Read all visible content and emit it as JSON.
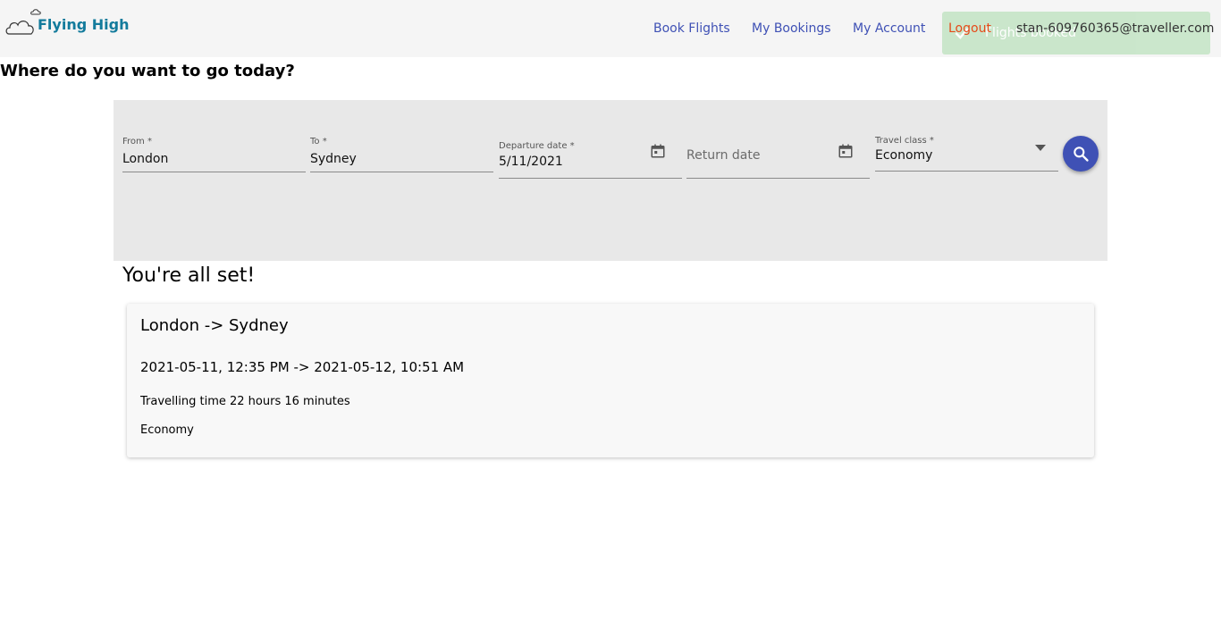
{
  "header": {
    "logo_text": "Flying High",
    "nav": [
      {
        "label": "Book Flights"
      },
      {
        "label": "My Bookings"
      },
      {
        "label": "My Account"
      },
      {
        "label": "Logout"
      }
    ],
    "user_email": "stan-609760365@traveller.com",
    "toast_text": "Flights booked"
  },
  "page": {
    "title": "Where do you want to go today?"
  },
  "search": {
    "from": {
      "label": "From *",
      "value": "London"
    },
    "to": {
      "label": "To *",
      "value": "Sydney"
    },
    "departure": {
      "label": "Departure date *",
      "value": "5/11/2021"
    },
    "return": {
      "placeholder": "Return date"
    },
    "travel_class": {
      "label": "Travel class *",
      "value": "Economy"
    },
    "search_icon": "search-icon"
  },
  "result": {
    "heading": "You're all set!",
    "route": "London -> Sydney",
    "times": "2021-05-11, 12:35 PM -> 2021-05-12, 10:51 AM",
    "duration": "Travelling time 22 hours 16 minutes",
    "class": "Economy"
  },
  "colors": {
    "primary": "#3f51b5",
    "logout": "#e64a19",
    "toast_bg": "#c8e6c9",
    "panel_bg": "#e8e8e8"
  }
}
